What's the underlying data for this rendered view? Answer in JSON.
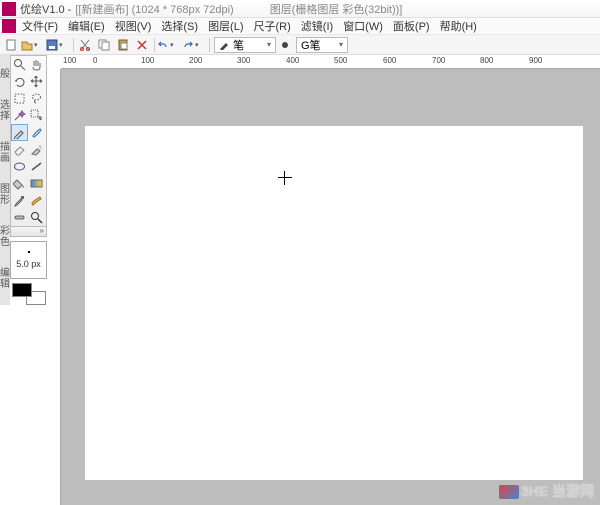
{
  "title": {
    "app": "优绘V1.0 -",
    "doc": "[[新建画布] (1024 * 768px 72dpi)",
    "layer": "图层(栅格图层 彩色(32bit))]"
  },
  "menu": {
    "file": "文件(F)",
    "edit": "编辑(E)",
    "view": "视图(V)",
    "select": "选择(S)",
    "layer": "图层(L)",
    "ruler": "尺子(R)",
    "filter": "滤镜(I)",
    "window": "窗口(W)",
    "panel": "面板(P)",
    "help": "帮助(H)"
  },
  "toolbar": {
    "pen_label": "笔",
    "pen2_label": "G笔"
  },
  "side_groups": {
    "g1": "般",
    "g2": "选择",
    "g3": "描画",
    "g4": "图形",
    "g5": "彩色",
    "g6": "编辑"
  },
  "brush": {
    "size": "5.0 px"
  },
  "ruler_ticks": [
    "100",
    "0",
    "100",
    "200",
    "300",
    "400",
    "500",
    "600",
    "700",
    "800",
    "900"
  ],
  "watermark": "当游网",
  "watermark_prefix": "3HE"
}
